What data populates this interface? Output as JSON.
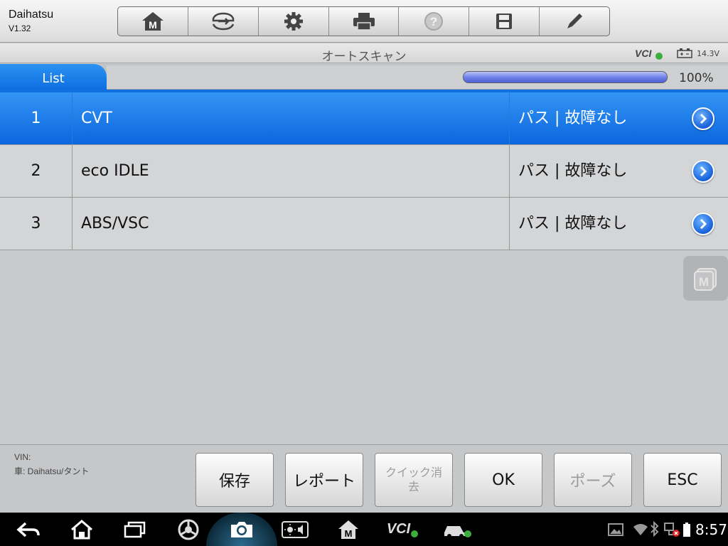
{
  "header": {
    "brand": "Daihatsu",
    "version": "V1.32",
    "toolbar": [
      "home-icon",
      "vehicle-swap-icon",
      "gear-icon",
      "printer-icon",
      "help-icon",
      "save-icon",
      "pencil-icon"
    ]
  },
  "titlebar": {
    "title": "オートスキャン",
    "vci": "VCI",
    "voltage": "14.3V"
  },
  "tab": {
    "label": "List",
    "progress_percent": 100,
    "progress_label": "100%"
  },
  "rows": [
    {
      "num": "1",
      "name": "CVT",
      "status": "パス | 故障なし",
      "selected": true
    },
    {
      "num": "2",
      "name": "eco IDLE",
      "status": "パス | 故障なし",
      "selected": false
    },
    {
      "num": "3",
      "name": "ABS/VSC",
      "status": "パス | 故障なし",
      "selected": false
    }
  ],
  "footer": {
    "vin": "VIN:",
    "vehicle": "車: Daihatsu/タント",
    "buttons": [
      {
        "label": "保存",
        "enabled": true
      },
      {
        "label": "レポート",
        "enabled": true
      },
      {
        "label": "クイック消去",
        "enabled": false
      },
      {
        "label": "OK",
        "enabled": true
      },
      {
        "label": "ポーズ",
        "enabled": false
      },
      {
        "label": "ESC",
        "enabled": true
      }
    ]
  },
  "system": {
    "clock": "8:57",
    "vci_label": "VCI"
  },
  "colors": {
    "accent": "#0d6cdf",
    "status_ok": "#3cae3c"
  }
}
